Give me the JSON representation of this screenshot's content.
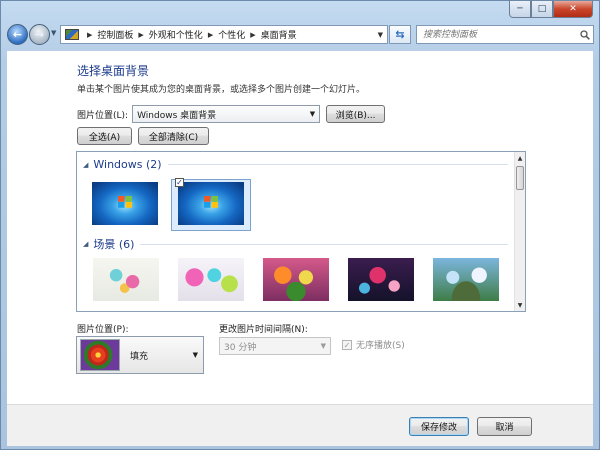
{
  "window": {
    "minimize_icon": "─",
    "maximize_icon": "□",
    "close_icon": "✕"
  },
  "nav": {
    "back_icon": "←",
    "forward_icon": "→",
    "breadcrumb": [
      "控制面板",
      "外观和个性化",
      "个性化",
      "桌面背景"
    ],
    "search_placeholder": "搜索控制面板"
  },
  "page": {
    "title": "选择桌面背景",
    "subtitle": "单击某个图片使其成为您的桌面背景，或选择多个图片创建一个幻灯片。"
  },
  "location": {
    "label": "图片位置(L):",
    "value": "Windows 桌面背景",
    "browse_label": "浏览(B)...",
    "select_all_label": "全选(A)",
    "clear_all_label": "全部清除(C)"
  },
  "gallery": {
    "groups": [
      {
        "title": "Windows (2)",
        "items": [
          {
            "checked": false,
            "wallpaper": "windows-7-logo"
          },
          {
            "checked": true,
            "wallpaper": "windows-7-logo"
          }
        ]
      },
      {
        "title": "场景 (6)",
        "items": [
          {
            "wallpaper": "scene-1"
          },
          {
            "wallpaper": "scene-2"
          },
          {
            "wallpaper": "scene-3"
          },
          {
            "wallpaper": "scene-4"
          },
          {
            "wallpaper": "scene-5"
          }
        ]
      }
    ],
    "check_mark": "✓"
  },
  "options": {
    "position_label": "图片位置(P):",
    "position_value": "填充",
    "interval_label": "更改图片时间间隔(N):",
    "interval_value": "30 分钟",
    "shuffle_label": "无序播放(S)",
    "shuffle_checked": true
  },
  "footer": {
    "save_label": "保存修改",
    "cancel_label": "取消"
  },
  "colors": {
    "title_blue": "#1e3c8c",
    "frame_blue": "#b4cde6"
  }
}
